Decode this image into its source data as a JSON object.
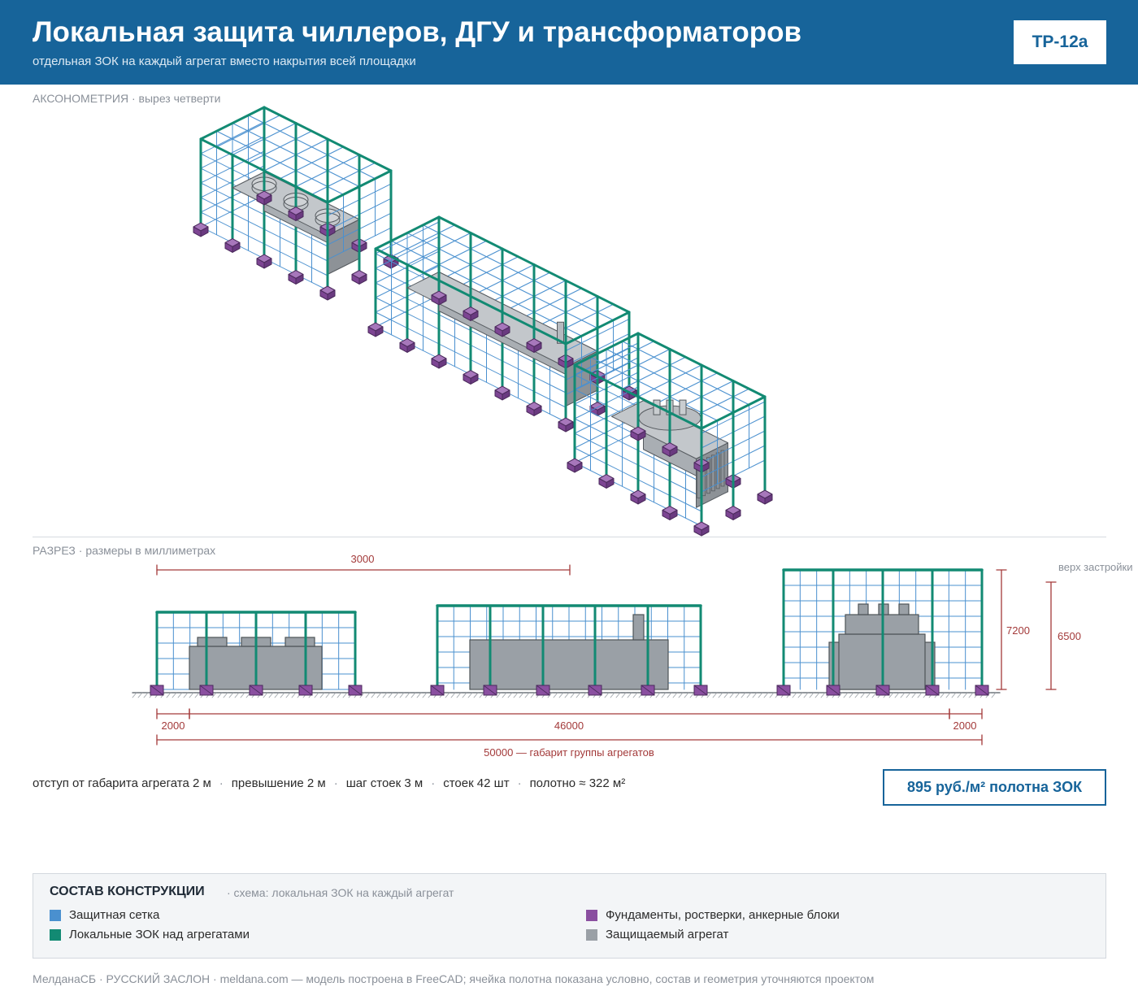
{
  "header": {
    "title": "Локальная защита чиллеров, ДГУ и трансформаторов",
    "subtitle": "отдельная ЗОК на каждый агрегат вместо накрытия всей площадки",
    "code": "TP-12a"
  },
  "axonometry": {
    "label": "АКСОНОМЕТРИЯ",
    "sublabel": " · вырез четверти"
  },
  "section": {
    "label": "РАЗРЕЗ",
    "sublabel": " · размеры в миллиметрах",
    "dim_top": "3000",
    "dim_left": "2000",
    "dim_mid": "46000",
    "dim_right": "2000",
    "dim_total": "50000 — габарит группы агрегатов",
    "dim_height_frame": "7200",
    "dim_height_building": "6500",
    "building_label": "верх застройки"
  },
  "params": {
    "p1": "отступ от габарита агрегата 2 м",
    "p2": "превышение 2 м",
    "p3": "шаг стоек 3 м",
    "p4": "стоек 42 шт",
    "p5": "полотно ≈ 322 м²",
    "separator": "·"
  },
  "price": "895 руб./м² полотна ЗОК",
  "legend": {
    "title": "СОСТАВ КОНСТРУКЦИИ",
    "subtitle": "· схема: локальная ЗОК на каждый агрегат",
    "items": [
      {
        "label": "Защитная сетка",
        "color": "#4a90cf"
      },
      {
        "label": "Локальные ЗОК над агрегатами",
        "color": "#128a73"
      },
      {
        "label": "Фундаменты, ростверки, анкерные блоки",
        "color": "#8a4fa0"
      },
      {
        "label": "Защищаемый агрегат",
        "color": "#9aa0a6"
      }
    ]
  },
  "footer": "МелданаСБ · РУССКИЙ ЗАСЛОН · meldana.com — модель построена в FreeCAD; ячейка полотна показана условно, состав и геометрия уточняются проектом",
  "colors": {
    "brand": "#17649a",
    "mesh": "#4a90cf",
    "frame": "#128a73",
    "foundation": "#8a4fa0",
    "unit": "#9aa0a6",
    "dimension": "#a33a3a"
  }
}
